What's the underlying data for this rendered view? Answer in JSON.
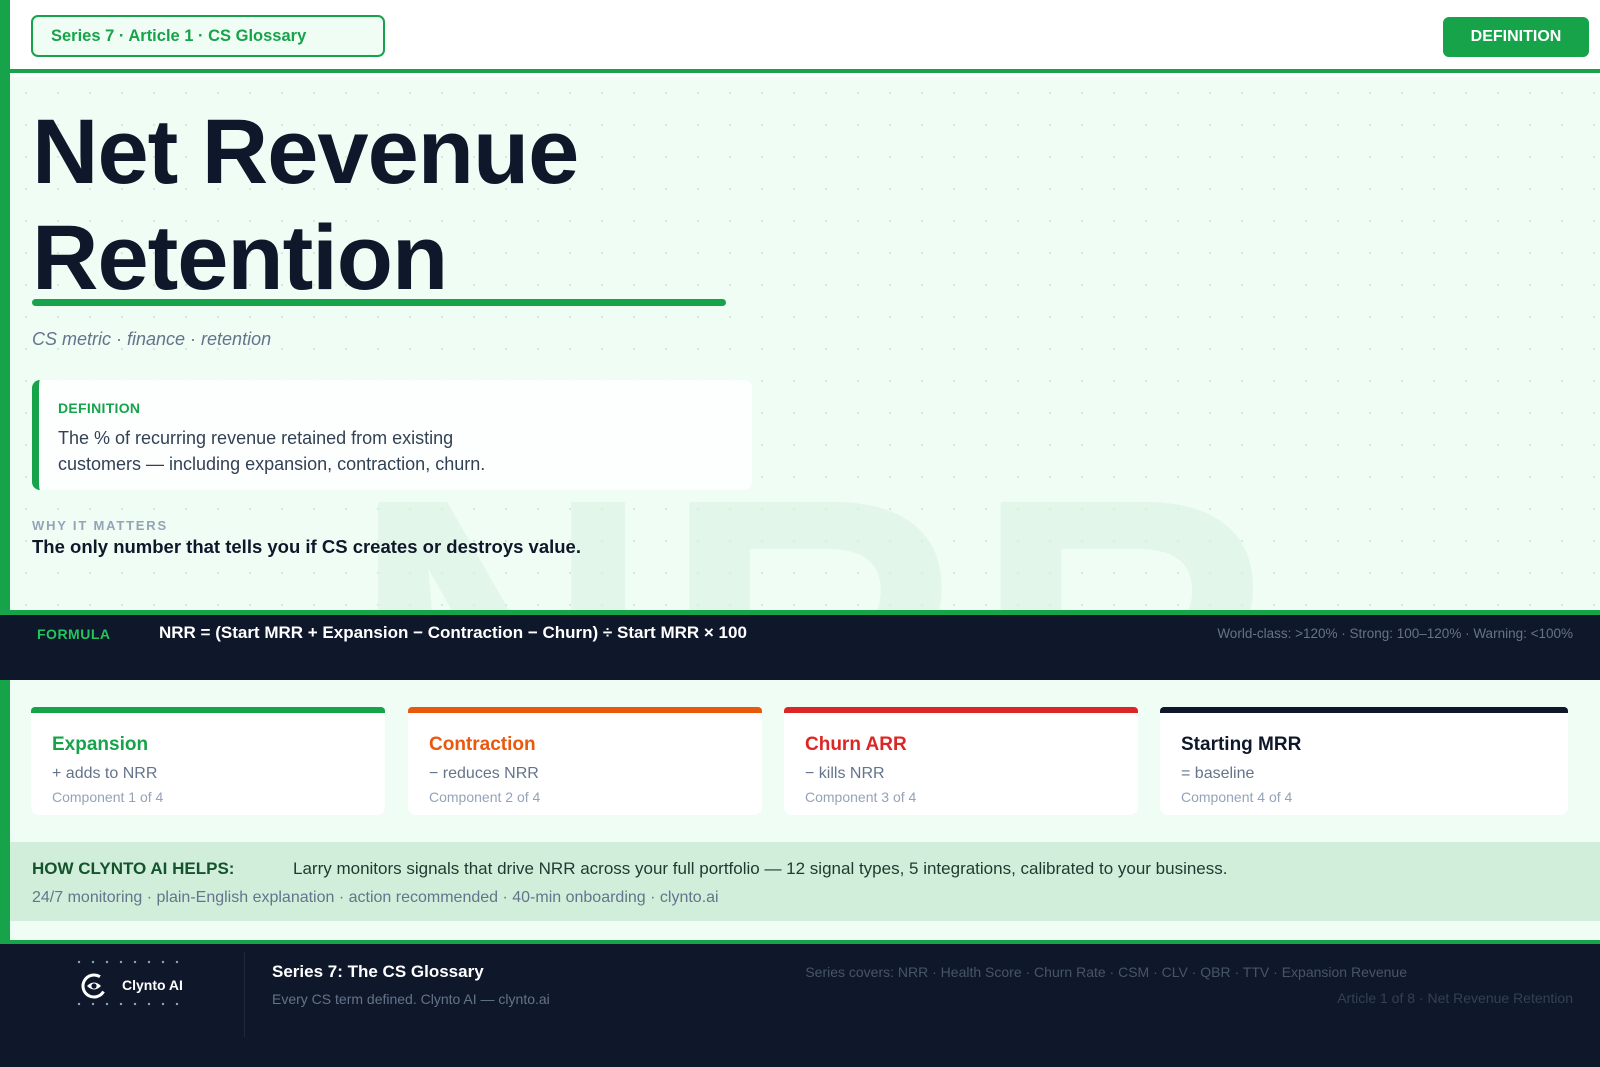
{
  "header": {
    "series_tag": "Series 7 · Article 1 · CS Glossary",
    "badge": "DEFINITION"
  },
  "hero": {
    "watermark": "NRR",
    "title": "Net Revenue Retention",
    "tags": "CS metric · finance · retention",
    "definition": {
      "label": "DEFINITION",
      "text": "The % of recurring revenue retained from existing customers — including expansion, contraction, churn."
    },
    "why": {
      "label": "WHY IT MATTERS",
      "text": "The only number that tells you if CS creates or destroys value."
    }
  },
  "formula": {
    "label": "FORMULA",
    "text": "NRR = (Start MRR + Expansion − Contraction − Churn) ÷ Start MRR × 100",
    "benchmarks": "World-class: >120% · Strong: 100–120% · Warning: <100%"
  },
  "components": [
    {
      "name": "Expansion",
      "effect": "+ adds to NRR",
      "index": "Component 1 of 4",
      "color": "#16a34a"
    },
    {
      "name": "Contraction",
      "effect": "− reduces NRR",
      "index": "Component 2 of 4",
      "color": "#ea580c"
    },
    {
      "name": "Churn ARR",
      "effect": "− kills NRR",
      "index": "Component 3 of 4",
      "color": "#dc2626"
    },
    {
      "name": "Starting MRR",
      "effect": "= baseline",
      "index": "Component 4 of 4",
      "color": "#0f172a"
    }
  ],
  "helps": {
    "label": "HOW CLYNTO AI HELPS:",
    "text": "Larry monitors signals that drive NRR across your full portfolio — 12 signal types, 5 integrations, calibrated to your business.",
    "sub": "24/7 monitoring · plain-English explanation · action recommended · 40-min onboarding · clynto.ai"
  },
  "footer": {
    "logo_icon": "clynto-logo-icon",
    "logo_name": "Clynto AI",
    "title": "Series 7: The CS Glossary",
    "subtitle": "Every CS term defined. Clynto AI — clynto.ai",
    "covers": "Series covers: NRR · Health Score · Churn Rate · CSM · CLV · QBR · TTV · Expansion Revenue",
    "article": "Article 1 of 8 · Net Revenue Retention"
  }
}
